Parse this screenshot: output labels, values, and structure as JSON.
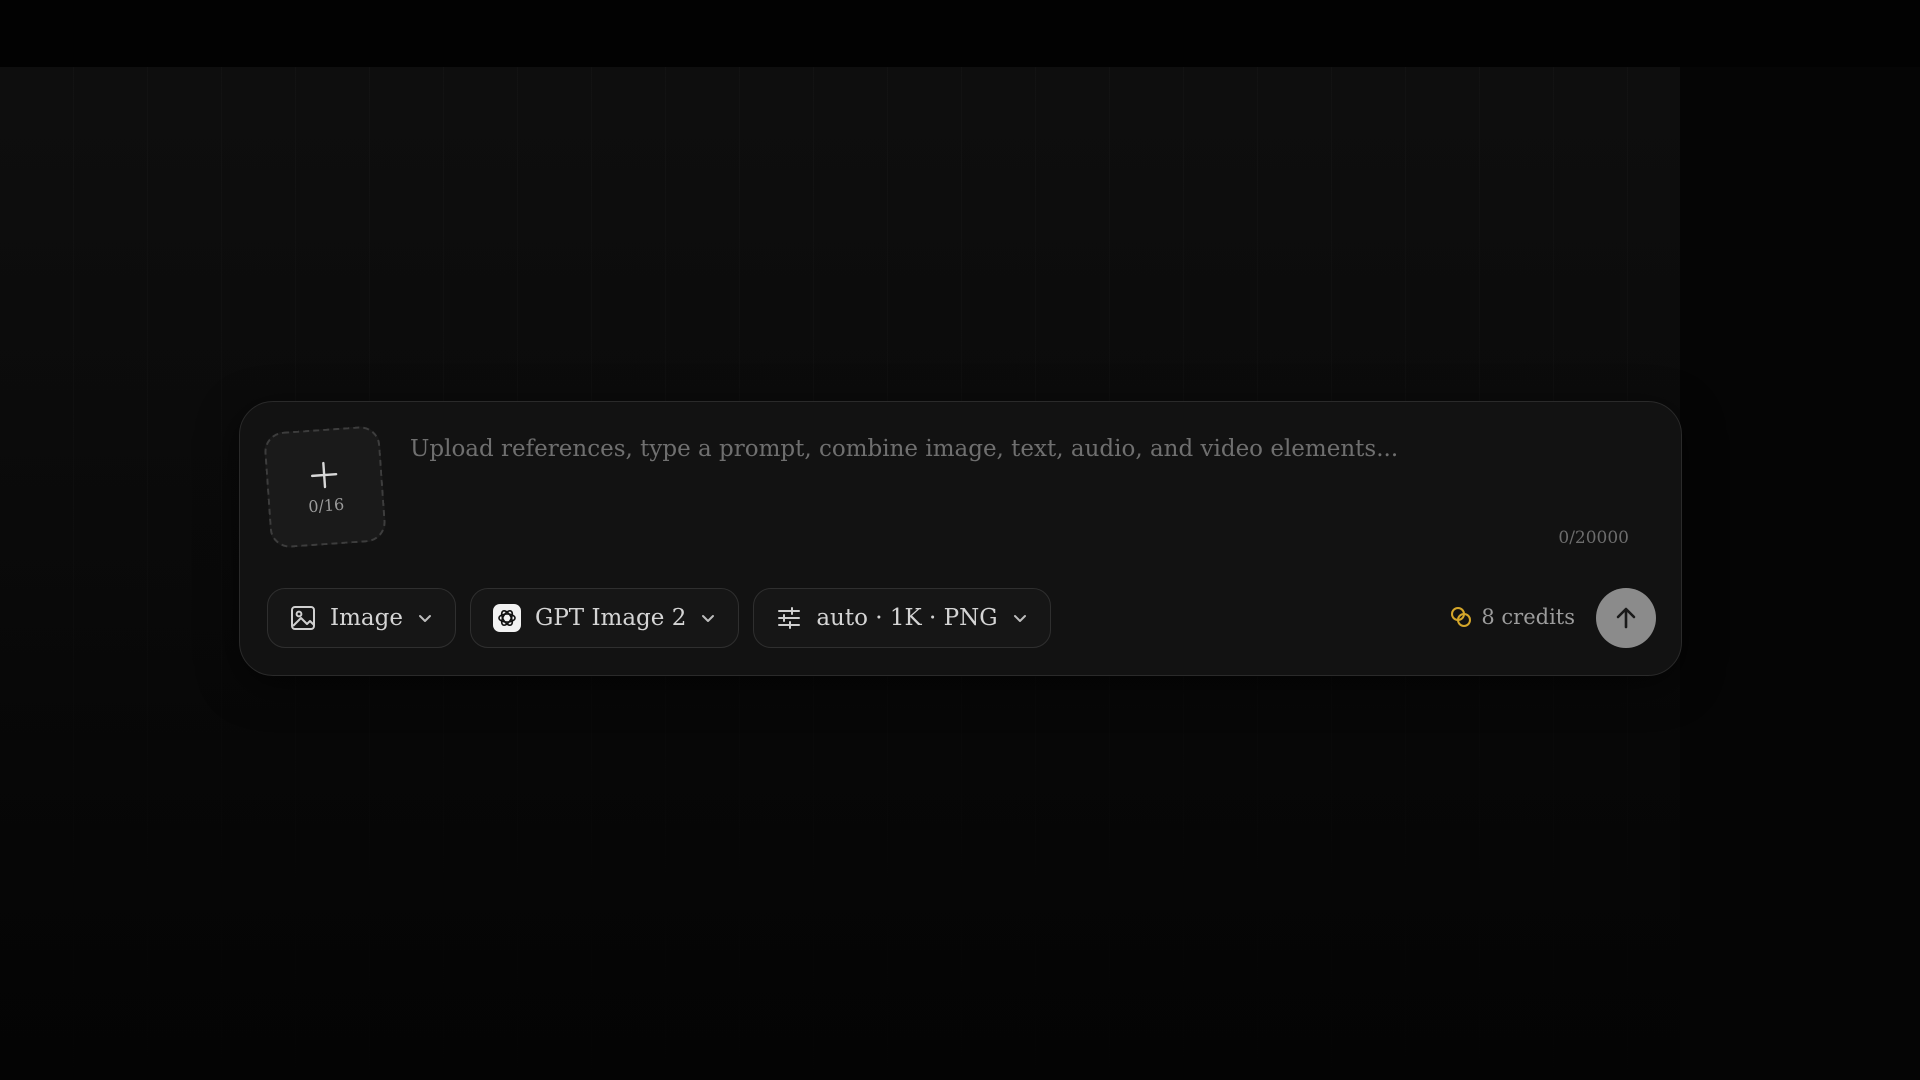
{
  "composer": {
    "upload": {
      "count": "0/16",
      "icon": "plus-icon"
    },
    "prompt": {
      "placeholder": "Upload references, type a prompt, combine image, text, audio, and video elements...",
      "value": ""
    },
    "char_count": "0/20000",
    "mode_selector": {
      "label": "Image",
      "icon": "image-icon"
    },
    "model_selector": {
      "label": "GPT Image 2",
      "icon": "openai-icon"
    },
    "settings_selector": {
      "label": "auto · 1K · PNG",
      "icon": "sliders-icon"
    },
    "credits": {
      "label": "8 credits",
      "icon": "coins-icon",
      "color": "#d4a62a"
    },
    "send_button": {
      "icon": "arrow-up-icon"
    }
  }
}
